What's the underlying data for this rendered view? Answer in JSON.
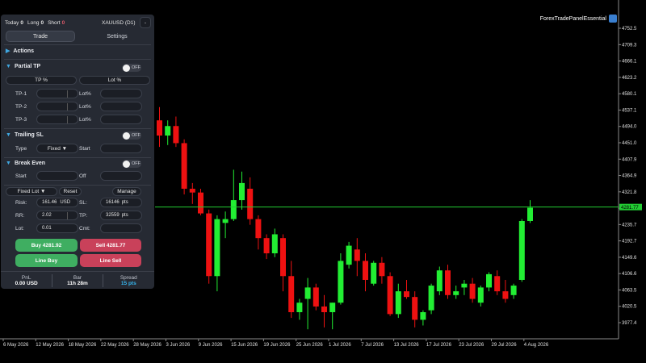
{
  "brand": {
    "label": "ForexTradePanelEssential",
    "icon": "panel-app-icon"
  },
  "panel": {
    "header": {
      "today_label": "Today",
      "today_value": "0",
      "long_label": "Long",
      "long_value": "0",
      "short_label": "Short",
      "short_value": "0",
      "symbol": "XAUUSD (D1)",
      "minimize": "-"
    },
    "tabs": [
      {
        "label": "Trade",
        "active": true
      },
      {
        "label": "Settings",
        "active": false
      }
    ],
    "actions": {
      "title": "Actions"
    },
    "partial_tp": {
      "title": "Partial TP",
      "toggle": "OFF",
      "tp_pct_button": "TP %",
      "lot_pct_button": "Lot %",
      "rows": [
        {
          "label": "TP-1",
          "lot_label": "Lot%"
        },
        {
          "label": "TP-2",
          "lot_label": "Lot%"
        },
        {
          "label": "TP-3",
          "lot_label": "Lot%"
        }
      ]
    },
    "trailing_sl": {
      "title": "Trailing SL",
      "toggle": "OFF",
      "type_label": "Type",
      "type_value": "Fixed ▼",
      "start_label": "Start"
    },
    "break_even": {
      "title": "Break Even",
      "toggle": "OFF",
      "start_label": "Start",
      "off_label": "Off"
    },
    "order": {
      "lot_mode": "Fixed Lot ▼",
      "reset": "Reset",
      "manage": "Manage",
      "risk_label": "Risk:",
      "risk_value": "161.46",
      "risk_unit": "USD",
      "sl_label": "SL:",
      "sl_value": "16146",
      "sl_unit": "pts",
      "rr_label": "RR:",
      "rr_value": "2.02",
      "tp_label": "TP:",
      "tp_value": "32559",
      "tp_unit": "pts",
      "lot_label": "Lot:",
      "lot_value": "0.01",
      "cmt_label": "Cmt:"
    },
    "buy_button": "Buy  4281.92",
    "sell_button": "Sell  4281.77",
    "line_buy": "Line Buy",
    "line_sell": "Line Sell",
    "footer": [
      {
        "label": "PnL",
        "value": "0.00 USD"
      },
      {
        "label": "Bar",
        "value": "11h 28m"
      },
      {
        "label": "Spread",
        "value": "15 pts"
      }
    ],
    "colors": {
      "bg": "#262a33",
      "buy": "#3fae61",
      "sell": "#c9415a",
      "accent": "#36b7f0"
    }
  },
  "chart_data": {
    "type": "candlestick",
    "ylim": [
      3950,
      4800
    ],
    "y_ticks": [
      4752.5,
      4709.3,
      4666.1,
      4623.2,
      4580.1,
      4537.1,
      4494.0,
      4451.0,
      4407.9,
      4364.9,
      4321.8,
      4278.7,
      4235.7,
      4192.7,
      4149.6,
      4106.6,
      4063.5,
      4020.5,
      3977.4
    ],
    "price_line": 4281.77,
    "price_line_label": "4281.77",
    "x_labels": [
      "6 May 2026",
      "12 May 2026",
      "18 May 2026",
      "22 May 2026",
      "28 May 2026",
      "3 Jun 2026",
      "9 Jun 2026",
      "15 Jun 2026",
      "19 Jun 2026",
      "25 Jun 2026",
      "1 Jul 2026",
      "7 Jul 2026",
      "13 Jul 2026",
      "17 Jul 2026",
      "23 Jul 2026",
      "29 Jul 2026",
      "4 Aug 2026"
    ],
    "candles": [
      {
        "o": 4510,
        "h": 4545,
        "l": 4440,
        "c": 4470
      },
      {
        "o": 4470,
        "h": 4510,
        "l": 4445,
        "c": 4495
      },
      {
        "o": 4495,
        "h": 4520,
        "l": 4440,
        "c": 4450
      },
      {
        "o": 4450,
        "h": 4460,
        "l": 4315,
        "c": 4330
      },
      {
        "o": 4330,
        "h": 4345,
        "l": 4290,
        "c": 4320
      },
      {
        "o": 4320,
        "h": 4330,
        "l": 4260,
        "c": 4265
      },
      {
        "o": 4265,
        "h": 4275,
        "l": 4080,
        "c": 4100
      },
      {
        "o": 4100,
        "h": 4260,
        "l": 4060,
        "c": 4250
      },
      {
        "o": 4240,
        "h": 4270,
        "l": 4200,
        "c": 4250
      },
      {
        "o": 4250,
        "h": 4380,
        "l": 4245,
        "c": 4300
      },
      {
        "o": 4300,
        "h": 4375,
        "l": 4275,
        "c": 4345
      },
      {
        "o": 4330,
        "h": 4360,
        "l": 4235,
        "c": 4250
      },
      {
        "o": 4250,
        "h": 4260,
        "l": 4170,
        "c": 4200
      },
      {
        "o": 4200,
        "h": 4210,
        "l": 4145,
        "c": 4160
      },
      {
        "o": 4160,
        "h": 4225,
        "l": 4150,
        "c": 4210
      },
      {
        "o": 4200,
        "h": 4210,
        "l": 4060,
        "c": 4100
      },
      {
        "o": 4100,
        "h": 4140,
        "l": 3990,
        "c": 4005
      },
      {
        "o": 4005,
        "h": 4040,
        "l": 3985,
        "c": 4030
      },
      {
        "o": 4040,
        "h": 4095,
        "l": 3960,
        "c": 4070
      },
      {
        "o": 4070,
        "h": 4080,
        "l": 4010,
        "c": 4020
      },
      {
        "o": 4020,
        "h": 4050,
        "l": 3965,
        "c": 4005
      },
      {
        "o": 4005,
        "h": 4030,
        "l": 3960,
        "c": 4030
      },
      {
        "o": 4030,
        "h": 4160,
        "l": 4025,
        "c": 4140
      },
      {
        "o": 4130,
        "h": 4190,
        "l": 4120,
        "c": 4180
      },
      {
        "o": 4170,
        "h": 4200,
        "l": 4100,
        "c": 4140
      },
      {
        "o": 4140,
        "h": 4160,
        "l": 4060,
        "c": 4090
      },
      {
        "o": 4080,
        "h": 4140,
        "l": 4075,
        "c": 4135
      },
      {
        "o": 4135,
        "h": 4150,
        "l": 4080,
        "c": 4100
      },
      {
        "o": 4100,
        "h": 4110,
        "l": 3995,
        "c": 4000
      },
      {
        "o": 4000,
        "h": 4080,
        "l": 3990,
        "c": 4060
      },
      {
        "o": 4060,
        "h": 4090,
        "l": 4040,
        "c": 4045
      },
      {
        "o": 4045,
        "h": 4060,
        "l": 3965,
        "c": 3985
      },
      {
        "o": 3985,
        "h": 4010,
        "l": 3970,
        "c": 4005
      },
      {
        "o": 4010,
        "h": 4080,
        "l": 4000,
        "c": 4075
      },
      {
        "o": 4060,
        "h": 4125,
        "l": 4050,
        "c": 4115
      },
      {
        "o": 4115,
        "h": 4130,
        "l": 4040,
        "c": 4050
      },
      {
        "o": 4050,
        "h": 4075,
        "l": 4040,
        "c": 4060
      },
      {
        "o": 4070,
        "h": 4090,
        "l": 4050,
        "c": 4080
      },
      {
        "o": 4080,
        "h": 4095,
        "l": 4030,
        "c": 4040
      },
      {
        "o": 4030,
        "h": 4075,
        "l": 4020,
        "c": 4070
      },
      {
        "o": 4070,
        "h": 4110,
        "l": 4060,
        "c": 4105
      },
      {
        "o": 4100,
        "h": 4115,
        "l": 4050,
        "c": 4060
      },
      {
        "o": 4060,
        "h": 4090,
        "l": 4030,
        "c": 4040
      },
      {
        "o": 4050,
        "h": 4080,
        "l": 4040,
        "c": 4075
      },
      {
        "o": 4090,
        "h": 4250,
        "l": 4085,
        "c": 4245
      },
      {
        "o": 4245,
        "h": 4300,
        "l": 4240,
        "c": 4280
      }
    ]
  }
}
